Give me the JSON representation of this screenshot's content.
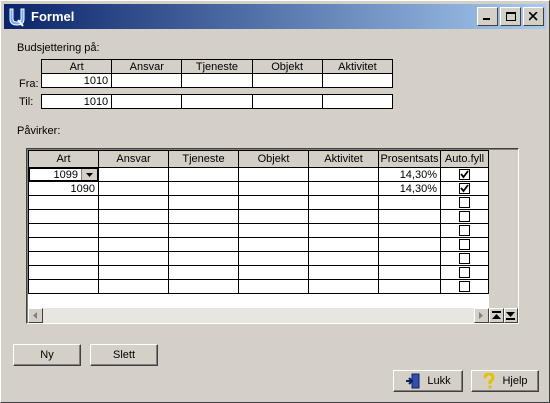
{
  "window": {
    "title": "Formel",
    "colors": {
      "titlebar": "#0a246a",
      "face": "#d4d0c8"
    }
  },
  "budget": {
    "label": "Budsjettering på:",
    "columns": [
      "Art",
      "Ansvar",
      "Tjeneste",
      "Objekt",
      "Aktivitet"
    ],
    "rows": [
      {
        "label": "Fra:",
        "values": [
          "1010",
          "",
          "",
          "",
          ""
        ]
      },
      {
        "label": "Til:",
        "values": [
          "1010",
          "",
          "",
          "",
          ""
        ]
      }
    ]
  },
  "affects": {
    "label": "Påvirker:",
    "columns": [
      "Art",
      "Ansvar",
      "Tjeneste",
      "Objekt",
      "Aktivitet",
      "Prosentsats",
      "Auto.fyll"
    ],
    "rows": [
      {
        "art": "1099",
        "ansvar": "",
        "tjeneste": "",
        "objekt": "",
        "aktivitet": "",
        "prosent": "14,30%",
        "auto": true
      },
      {
        "art": "1090",
        "ansvar": "",
        "tjeneste": "",
        "objekt": "",
        "aktivitet": "",
        "prosent": "14,30%",
        "auto": true
      },
      {
        "art": "",
        "ansvar": "",
        "tjeneste": "",
        "objekt": "",
        "aktivitet": "",
        "prosent": "",
        "auto": false
      },
      {
        "art": "",
        "ansvar": "",
        "tjeneste": "",
        "objekt": "",
        "aktivitet": "",
        "prosent": "",
        "auto": false
      },
      {
        "art": "",
        "ansvar": "",
        "tjeneste": "",
        "objekt": "",
        "aktivitet": "",
        "prosent": "",
        "auto": false
      },
      {
        "art": "",
        "ansvar": "",
        "tjeneste": "",
        "objekt": "",
        "aktivitet": "",
        "prosent": "",
        "auto": false
      },
      {
        "art": "",
        "ansvar": "",
        "tjeneste": "",
        "objekt": "",
        "aktivitet": "",
        "prosent": "",
        "auto": false
      },
      {
        "art": "",
        "ansvar": "",
        "tjeneste": "",
        "objekt": "",
        "aktivitet": "",
        "prosent": "",
        "auto": false
      },
      {
        "art": "",
        "ansvar": "",
        "tjeneste": "",
        "objekt": "",
        "aktivitet": "",
        "prosent": "",
        "auto": false
      }
    ]
  },
  "buttons": {
    "new": "Ny",
    "delete": "Slett",
    "close": "Lukk",
    "help": "Hjelp"
  }
}
